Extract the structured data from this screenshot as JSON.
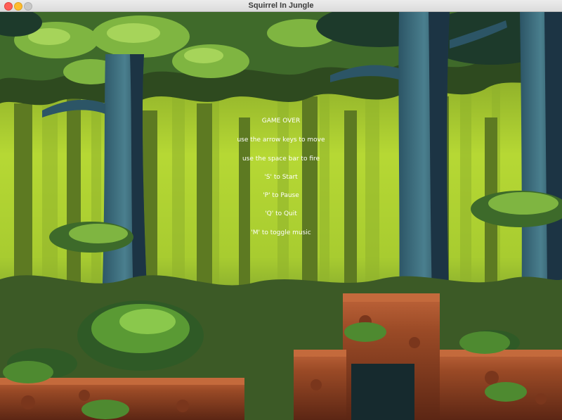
{
  "window": {
    "title": "Squirrel In Jungle"
  },
  "menu": {
    "lines": [
      "GAME OVER",
      "use the arrow keys to move",
      "use the space bar to fire",
      "'S' to Start",
      "'P' to Pause",
      "'Q' to Quit",
      "'M' to toggle music"
    ]
  },
  "colors": {
    "sky_glow": "#c6e83a",
    "canopy_dark": "#1d3a2b",
    "foliage_bright": "#7cb342",
    "trunk_blue": "#3d6a7a",
    "trunk_dark": "#1c3444",
    "dirt": "#a5502a",
    "dirt_dark": "#6b2d18",
    "text": "#ffffff"
  }
}
